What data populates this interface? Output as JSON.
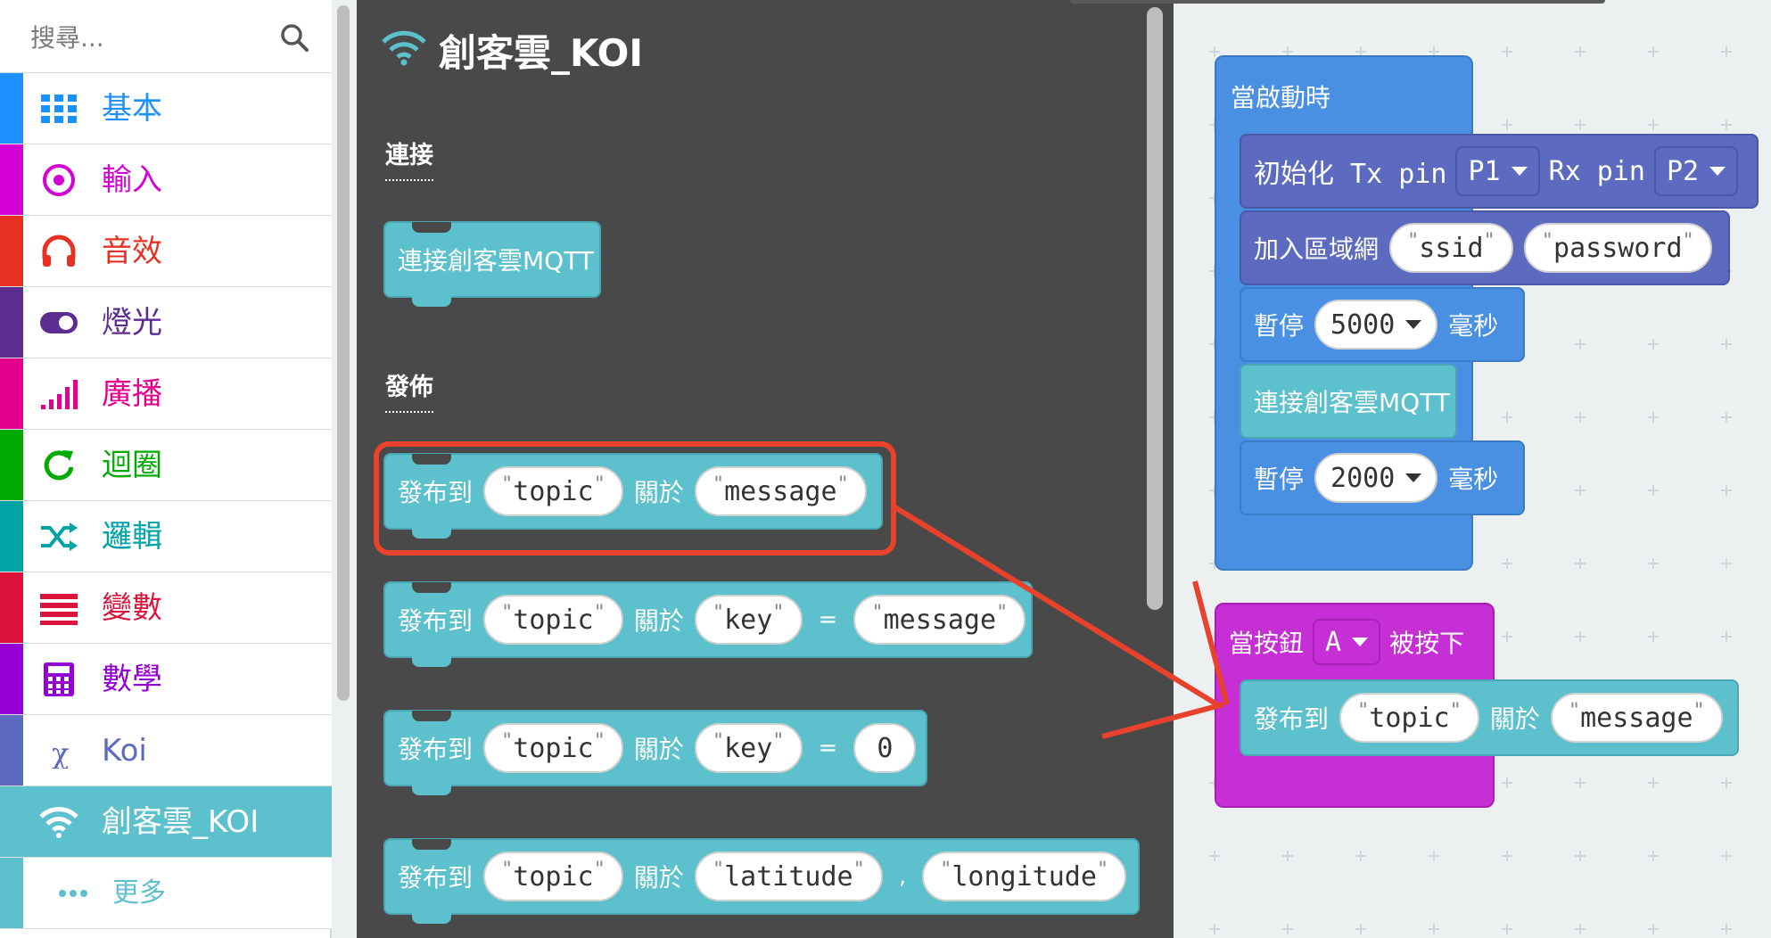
{
  "sidebar": {
    "search_placeholder": "搜尋...",
    "categories": [
      {
        "label": "基本",
        "color": "#1e90ff",
        "icon": "grid-icon"
      },
      {
        "label": "輸入",
        "color": "#d400d4",
        "icon": "target-icon"
      },
      {
        "label": "音效",
        "color": "#e63022",
        "icon": "headphones-icon"
      },
      {
        "label": "燈光",
        "color": "#5c2d91",
        "icon": "toggle-icon"
      },
      {
        "label": "廣播",
        "color": "#e3008c",
        "icon": "signal-bars-icon"
      },
      {
        "label": "迴圈",
        "color": "#00aa00",
        "icon": "refresh-icon"
      },
      {
        "label": "邏輯",
        "color": "#00a4a6",
        "icon": "shuffle-icon"
      },
      {
        "label": "變數",
        "color": "#dc143c",
        "icon": "list-icon"
      },
      {
        "label": "數學",
        "color": "#9400d3",
        "icon": "calculator-icon"
      },
      {
        "label": "Koi",
        "color": "#5c6bc0",
        "icon": "chi-icon"
      },
      {
        "label": "創客雲_KOI",
        "color": "#5cc0cd",
        "icon": "wifi-icon"
      },
      {
        "label": "更多",
        "color": "#5cc0cd",
        "icon": "ellipsis-icon"
      }
    ]
  },
  "flyout": {
    "title": "創客雲_KOI",
    "section_connect": "連接",
    "section_publish": "發佈",
    "connect_block": "連接創客雲MQTT",
    "publish_label": "發布到",
    "about_label": "關於",
    "eq": "=",
    "comma": ",",
    "topic": "topic",
    "message": "message",
    "key": "key",
    "zero": "0",
    "latitude": "latitude",
    "longitude": "longitude"
  },
  "workspace": {
    "on_start": "當啟動時",
    "init_label": "初始化 Tx pin",
    "tx_pin": "P1",
    "rx_label": "Rx pin",
    "rx_pin": "P2",
    "wifi_label": "加入區域網",
    "ssid": "ssid",
    "password": "password",
    "pause_label": "暫停",
    "pause1": "5000",
    "ms_label": "毫秒",
    "connect": "連接創客雲MQTT",
    "pause2": "2000",
    "on_button": "當按鈕",
    "button_value": "A",
    "pressed": "被按下",
    "publish_label": "發布到",
    "topic": "topic",
    "about_label": "關於",
    "message": "message"
  },
  "colors": {
    "cyan": "#5cc0cd",
    "blue": "#4a90e2",
    "magenta": "#c72fd6",
    "highlight": "#e8412c"
  }
}
